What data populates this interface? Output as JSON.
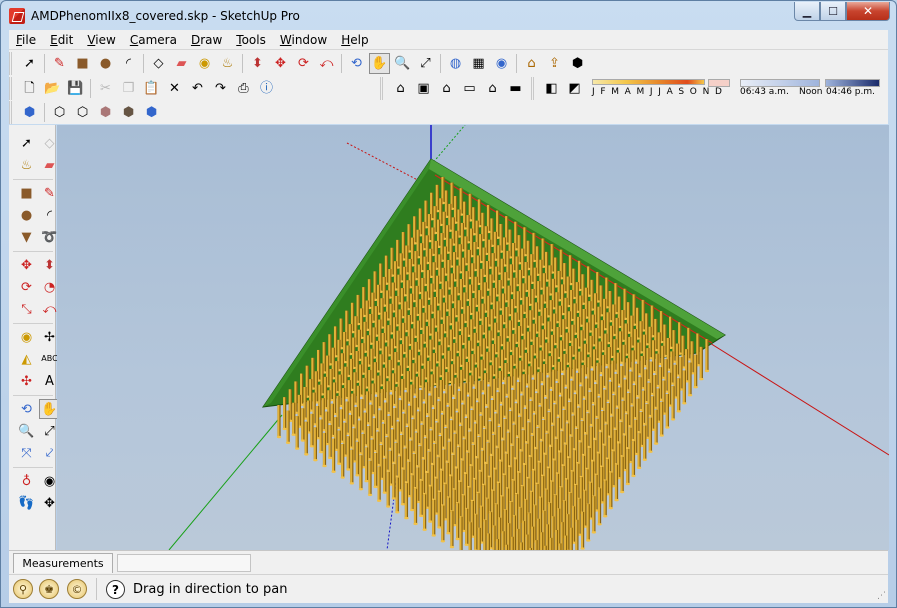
{
  "window": {
    "title": "AMDPhenomIIx8_covered.skp - SketchUp Pro",
    "minimize_symbol": "▁",
    "maximize_symbol": "☐",
    "close_symbol": "✕"
  },
  "menu": [
    {
      "key": "F",
      "rest": "ile"
    },
    {
      "key": "E",
      "rest": "dit"
    },
    {
      "key": "V",
      "rest": "iew"
    },
    {
      "key": "C",
      "rest": "amera"
    },
    {
      "key": "D",
      "rest": "raw"
    },
    {
      "key": "T",
      "rest": "ools"
    },
    {
      "key": "W",
      "rest": "indow"
    },
    {
      "key": "H",
      "rest": "elp"
    }
  ],
  "shadow": {
    "months": [
      "J",
      "F",
      "M",
      "A",
      "M",
      "J",
      "J",
      "A",
      "S",
      "O",
      "N",
      "D"
    ],
    "time_start": "06:43 a.m.",
    "time_mid": "Noon",
    "time_end": "04:46 p.m."
  },
  "measurements_label": "Measurements",
  "status_text": "Drag in direction to pan",
  "help_glyph": "?",
  "geo_icons": [
    "geolocation-icon",
    "credits-icon",
    "copyright-icon"
  ],
  "geo_glyphs": [
    "⚲",
    "♚",
    "©"
  ],
  "grip_glyph": "⋰",
  "colors": {
    "pcb_green": "#2f7d1f",
    "pin_gold": "#e2b23a",
    "axis_red": "#c81414",
    "axis_green": "#18a018",
    "axis_blue": "#1414c8",
    "sky": "#aebfd3"
  }
}
